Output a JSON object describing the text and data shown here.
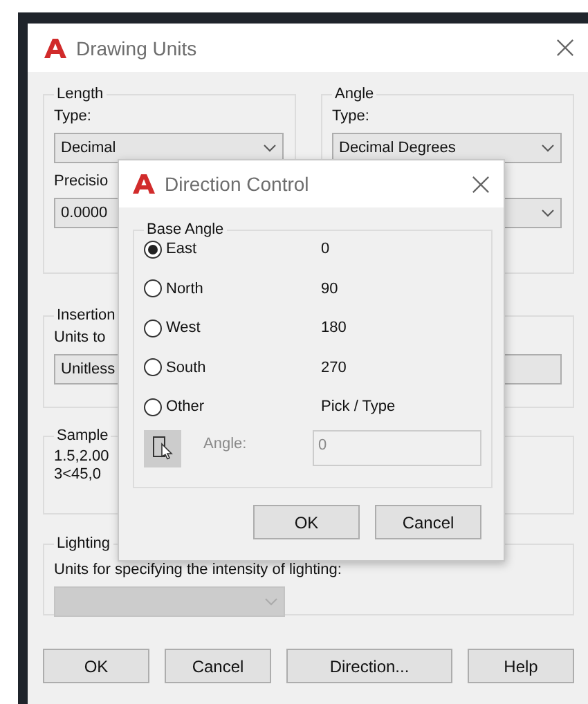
{
  "window": {
    "title": "Drawing Units"
  },
  "length": {
    "legend": "Length",
    "type_label": "Type:",
    "type_value": "Decimal",
    "precision_label": "Precisio",
    "precision_value": "0.0000"
  },
  "angle": {
    "legend": "Angle",
    "type_label": "Type:",
    "type_value": "Decimal Degrees"
  },
  "insertion": {
    "legend": "Insertion",
    "label": "Units to",
    "value": "Unitless"
  },
  "sample": {
    "legend": "Sample",
    "lines": [
      "1.5,2.00",
      "3<45,0"
    ]
  },
  "lighting": {
    "legend": "Lighting",
    "label": "Units for specifying the intensity of lighting:",
    "disabled": true
  },
  "buttons": [
    "OK",
    "Cancel",
    "Direction...",
    "Help"
  ],
  "dialog": {
    "title": "Direction Control",
    "legend": "Base Angle",
    "options": [
      {
        "label": "East",
        "value": "0",
        "selected": true
      },
      {
        "label": "North",
        "value": "90",
        "selected": false
      },
      {
        "label": "West",
        "value": "180",
        "selected": false
      },
      {
        "label": "South",
        "value": "270",
        "selected": false
      },
      {
        "label": "Other",
        "value": "Pick / Type",
        "selected": false
      }
    ],
    "angle_label": "Angle:",
    "angle_value": "0",
    "angle_disabled": true,
    "buttons": [
      "OK",
      "Cancel"
    ]
  }
}
